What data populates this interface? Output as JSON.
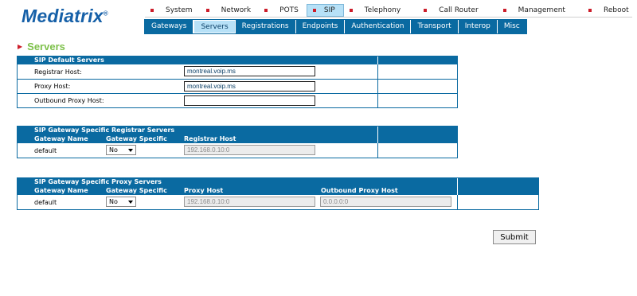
{
  "logo": {
    "text": "Mediatrix",
    "reg": "®"
  },
  "top_nav": [
    {
      "label": "System",
      "active": false
    },
    {
      "label": "Network",
      "active": false
    },
    {
      "label": "POTS",
      "active": false
    },
    {
      "label": "SIP",
      "active": true
    },
    {
      "label": "Telephony",
      "active": false
    },
    {
      "label": "Call Router",
      "active": false
    },
    {
      "label": "Management",
      "active": false
    },
    {
      "label": "Reboot",
      "active": false
    }
  ],
  "sub_nav": [
    {
      "label": "Gateways",
      "active": false
    },
    {
      "label": "Servers",
      "active": true
    },
    {
      "label": "Registrations",
      "active": false
    },
    {
      "label": "Endpoints",
      "active": false
    },
    {
      "label": "Authentication",
      "active": false
    },
    {
      "label": "Transport",
      "active": false
    },
    {
      "label": "Interop",
      "active": false
    },
    {
      "label": "Misc",
      "active": false
    }
  ],
  "page_title": "Servers",
  "default_servers": {
    "title": "SIP Default Servers",
    "registrar_label": "Registrar Host:",
    "registrar_value": "montreal.voip.ms",
    "proxy_label": "Proxy Host:",
    "proxy_value": "montreal.voip.ms",
    "outbound_label": "Outbound Proxy Host:",
    "outbound_value": ""
  },
  "registrar_servers": {
    "title": "SIP Gateway Specific Registrar Servers",
    "col_gateway": "Gateway Name",
    "col_specific": "Gateway Specific",
    "col_host": "Registrar Host",
    "row_name": "default",
    "row_specific": "No",
    "row_host": "192.168.0.10:0"
  },
  "proxy_servers": {
    "title": "SIP Gateway Specific Proxy Servers",
    "col_gateway": "Gateway Name",
    "col_specific": "Gateway Specific",
    "col_host": "Proxy Host",
    "col_outbound": "Outbound Proxy Host",
    "row_name": "default",
    "row_specific": "No",
    "row_host": "192.168.0.10:0",
    "row_outbound": "0.0.0.0:0"
  },
  "submit_label": "Submit",
  "colors": {
    "header_blue": "#0a6aa1",
    "active_tab": "#b7e1f7",
    "title_green": "#7dc04a",
    "bullet_red": "#cc1d2a",
    "logo_blue": "#1660a8"
  }
}
